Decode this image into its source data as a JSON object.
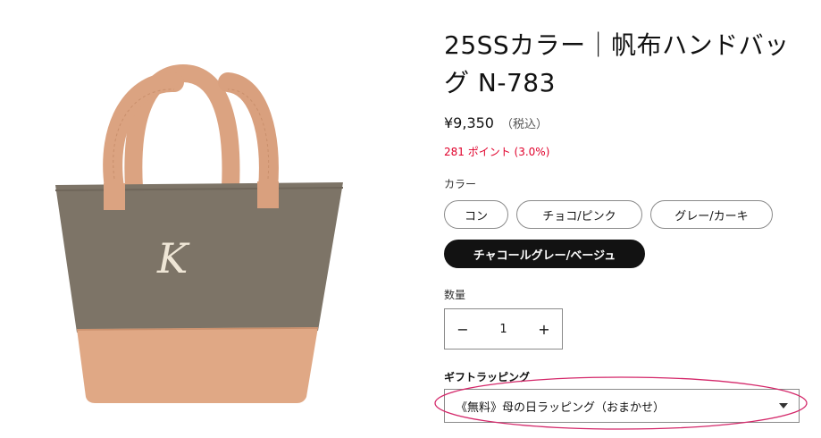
{
  "product": {
    "title": "25SSカラー｜帆布ハンドバッグ N-783",
    "price": "¥9,350",
    "tax_note": "（税込）",
    "points": "281 ポイント (3.0%)"
  },
  "color_selector": {
    "label": "カラー",
    "options": [
      "コン",
      "チョコ/ピンク",
      "グレー/カーキ",
      "チャコールグレー/ベージュ"
    ],
    "selected": "チャコールグレー/ベージュ"
  },
  "quantity": {
    "label": "数量",
    "minus": "−",
    "value": "1",
    "plus": "+"
  },
  "gift_wrapping": {
    "label": "ギフトラッピング",
    "selected_option": "《無料》母の日ラッピング（おまかせ）"
  },
  "image": {
    "logo_letter": "K"
  },
  "colors": {
    "bag_body": "#7d7467",
    "bag_bottom": "#e0a885",
    "handle": "#dba381",
    "points_red": "#e0002b",
    "annotation_pink": "#d4286a",
    "selected_swatch": "#121212"
  }
}
